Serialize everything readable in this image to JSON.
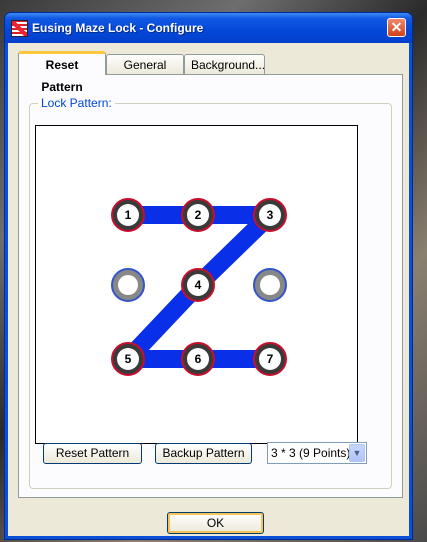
{
  "window": {
    "title": "Eusing Maze Lock - Configure",
    "close_glyph": "✕",
    "icon": "app-icon"
  },
  "tabs": [
    {
      "label": "Reset Pattern",
      "active": true
    },
    {
      "label": "General",
      "active": false
    },
    {
      "label": "Background...",
      "active": false
    }
  ],
  "group": {
    "label": "Lock Pattern:"
  },
  "pattern": {
    "grid": 3,
    "nodes": [
      {
        "label": "1",
        "selected": true
      },
      {
        "label": "2",
        "selected": true
      },
      {
        "label": "3",
        "selected": true
      },
      {
        "label": "",
        "selected": false
      },
      {
        "label": "4",
        "selected": true
      },
      {
        "label": "",
        "selected": false
      },
      {
        "label": "5",
        "selected": true
      },
      {
        "label": "6",
        "selected": true
      },
      {
        "label": "7",
        "selected": true
      }
    ],
    "path_order": [
      0,
      1,
      2,
      4,
      6,
      7,
      8
    ],
    "colors": {
      "line": "#0a2fe8",
      "selected_ring": "#c8102e",
      "idle_ring": "#3355cc",
      "node_outer": "#888888"
    }
  },
  "buttons": {
    "reset": "Reset Pattern",
    "backup": "Backup Pattern",
    "ok": "OK"
  },
  "grid_select": {
    "value": "3 * 3 (9 Points)"
  }
}
